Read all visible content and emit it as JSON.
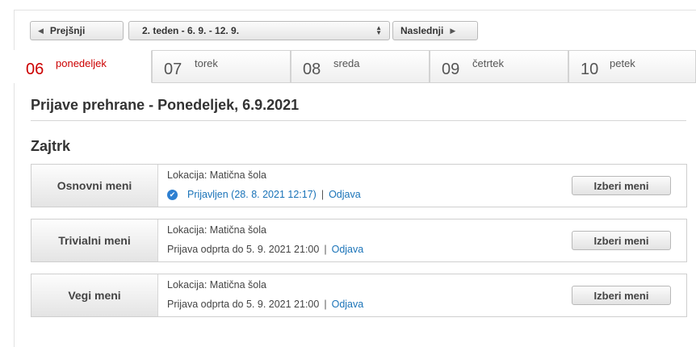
{
  "nav": {
    "prev_label": "Prejšnji",
    "week_value": "2. teden - 6. 9. - 12. 9.",
    "next_label": "Naslednji"
  },
  "tabs": [
    {
      "num": "06",
      "day": "ponedeljek",
      "active": true
    },
    {
      "num": "07",
      "day": "torek",
      "active": false
    },
    {
      "num": "08",
      "day": "sreda",
      "active": false
    },
    {
      "num": "09",
      "day": "četrtek",
      "active": false
    },
    {
      "num": "10",
      "day": "petek",
      "active": false
    }
  ],
  "page_title": "Prijave prehrane - Ponedeljek, 6.9.2021",
  "section_title": "Zajtrk",
  "menus": [
    {
      "name": "Osnovni meni",
      "location": "Lokacija: Matična šola",
      "status_text": "Prijavljen (28. 8. 2021 12:17)",
      "separator": "|",
      "action_link": "Odjava",
      "button_label": "Izberi meni"
    },
    {
      "name": "Trivialni meni",
      "location": "Lokacija: Matična šola",
      "status_text": "Prijava odprta do 5. 9. 2021 21:00",
      "separator": "|",
      "action_link": "Odjava",
      "button_label": "Izberi meni"
    },
    {
      "name": "Vegi meni",
      "location": "Lokacija: Matična šola",
      "status_text": "Prijava odprta do 5. 9. 2021 21:00",
      "separator": "|",
      "action_link": "Odjava",
      "button_label": "Izberi meni"
    }
  ],
  "colors": {
    "active_tab": "#cc0000",
    "link": "#1a73b8",
    "check_badge": "#2d7fd1"
  },
  "icons": {
    "prev": "triangle-left-icon",
    "next": "triangle-right-icon",
    "select": "updown-arrows-icon",
    "registered": "check-circle-icon"
  }
}
